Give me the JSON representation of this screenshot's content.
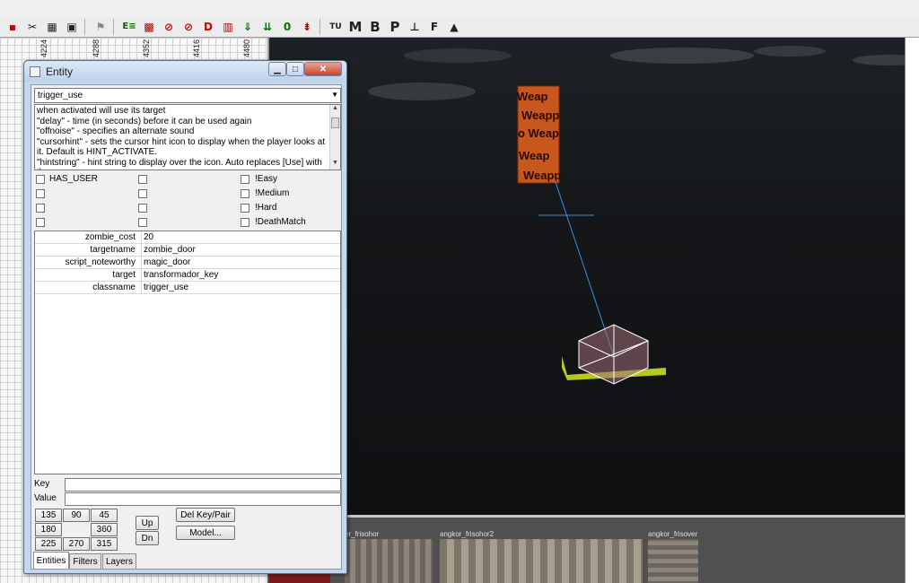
{
  "toolbar": {
    "icons": [
      "select-icon",
      "clipper-icon",
      "texture-icon",
      "scale-icon",
      "entity-icon",
      "brush-icon",
      "filter-icon",
      "curve-icon",
      "patch-icon",
      "down-arrow-icon",
      "down-arrow2-icon",
      "zero-icon",
      "merge-icon"
    ],
    "text_buttons": [
      "TU",
      "M",
      "B",
      "P",
      "F"
    ]
  },
  "grid2d": {
    "rulers": [
      "4224",
      "4288",
      "4352",
      "4416",
      "4480"
    ]
  },
  "entity_window": {
    "title": "Entity",
    "classname": "trigger_use",
    "description": "when activated will use its target\n\"delay\" - time (in seconds) before it can be used again\n\"offnoise\" - specifies an alternate sound\n\"cursorhint\" - sets the cursor hint icon to display when the player looks at it. Default is HINT_ACTIVATE.\n\"hintstring\" - hint string to display over the icon. Auto replaces [Use] with the",
    "flags": {
      "col1": [
        "HAS_USER",
        "",
        "",
        ""
      ],
      "col3": [
        "!Easy",
        "!Medium",
        "!Hard",
        "!DeathMatch"
      ]
    },
    "keyvalues": [
      {
        "key": "zombie_cost",
        "value": "20"
      },
      {
        "key": "targetname",
        "value": "zombie_door"
      },
      {
        "key": "script_noteworthy",
        "value": "magic_door"
      },
      {
        "key": "target",
        "value": "transformador_key"
      },
      {
        "key": "classname",
        "value": "trigger_use"
      }
    ],
    "key_label": "Key",
    "value_label": "Value",
    "key_value": "",
    "value_value": "",
    "angles": {
      "a135": "135",
      "a90": "90",
      "a45": "45",
      "a180": "180",
      "a360": "360",
      "a225": "225",
      "a270": "270",
      "a315": "315"
    },
    "buttons": {
      "up": "Up",
      "dn": "Dn",
      "del_key_pair": "Del Key/Pair",
      "model": "Model..."
    },
    "tabs": [
      "Entities",
      "Filters",
      "Layers"
    ]
  },
  "viewport": {
    "sign_text": [
      "Weap",
      "Weapp",
      "o Weap",
      "Weap",
      "Weapp"
    ]
  },
  "texture_browser": {
    "textures": [
      "er_frisohor",
      "angkor_frisohor2",
      "angkor_frisover"
    ]
  },
  "colors": {
    "entity_brush": "#c8571e",
    "trigger_box": "#ffffff",
    "link_line": "#3a8fd8",
    "ground_patch": "#b8c81e"
  }
}
